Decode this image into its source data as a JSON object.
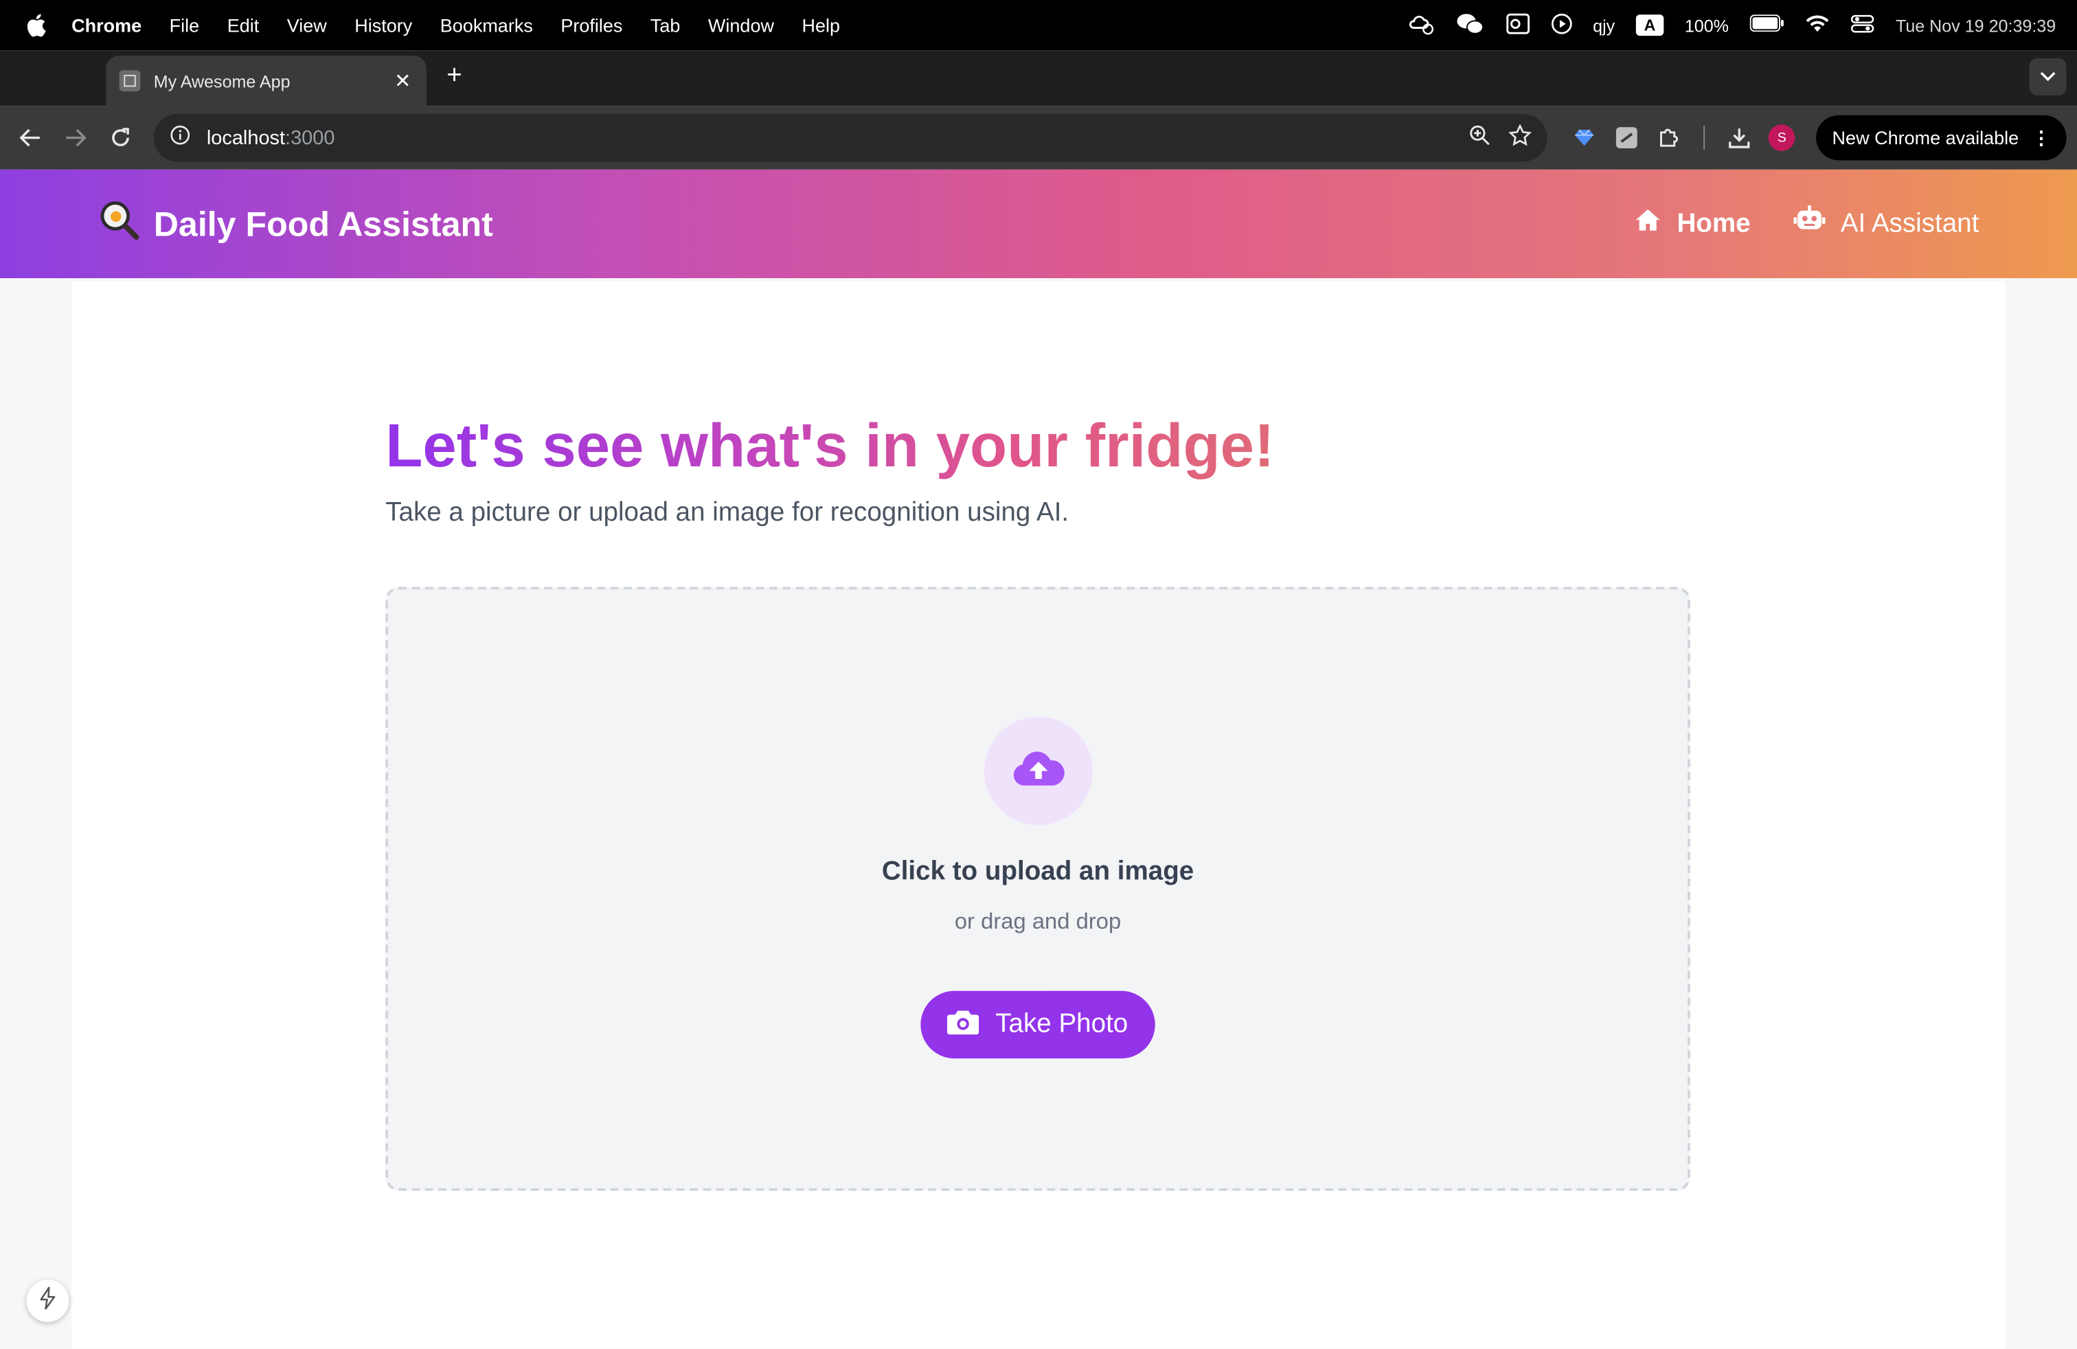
{
  "menubar": {
    "app": "Chrome",
    "items": [
      "File",
      "Edit",
      "View",
      "History",
      "Bookmarks",
      "Profiles",
      "Tab",
      "Window",
      "Help"
    ],
    "user": "qjy",
    "input_badge": "A",
    "battery": "100%",
    "datetime": "Tue Nov 19  20:39:39"
  },
  "browser": {
    "tab_title": "My Awesome App",
    "url_host": "localhost",
    "url_port": ":3000",
    "update_label": "New Chrome available",
    "profile_initial": "S"
  },
  "app": {
    "brand": "Daily Food Assistant",
    "nav": [
      {
        "label": "Home",
        "icon": "home-icon"
      },
      {
        "label": "AI Assistant",
        "icon": "robot-icon"
      }
    ]
  },
  "main": {
    "headline": "Let's see what's in your fridge!",
    "subhead": "Take a picture or upload an image for recognition using AI.",
    "upload_title": "Click to upload an image",
    "upload_sub": "or drag and drop",
    "take_photo_label": "Take Photo"
  },
  "colors": {
    "accent": "#9333ea",
    "header_start": "#8e3fe0",
    "header_end": "#ee9a4f"
  }
}
